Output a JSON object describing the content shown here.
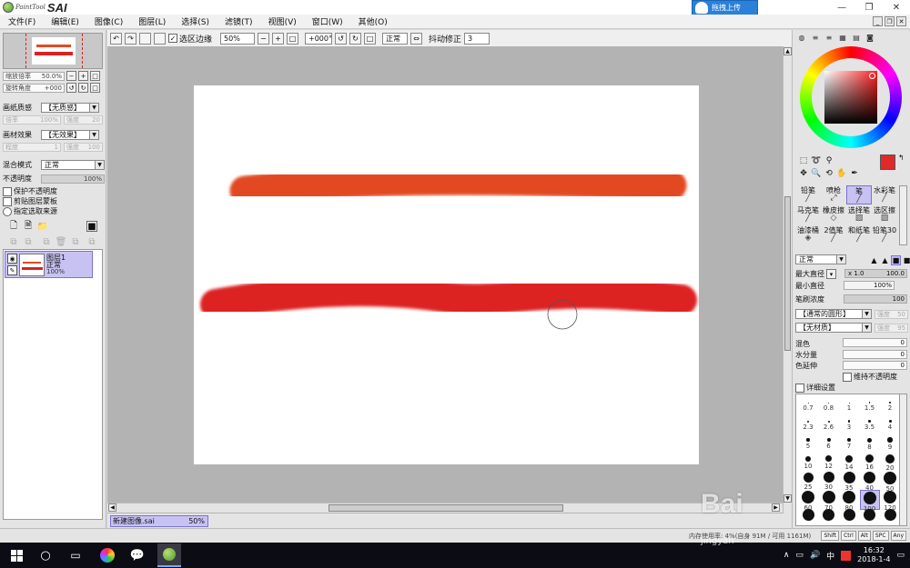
{
  "app": {
    "logo_small": "PaintTool",
    "logo_big": "SAI",
    "upload_button": "拖拽上传",
    "window_controls": [
      "—",
      "❐",
      "✕"
    ]
  },
  "menu": [
    "文件(F)",
    "编辑(E)",
    "图像(C)",
    "图层(L)",
    "选择(S)",
    "滤镜(T)",
    "视图(V)",
    "窗口(W)",
    "其他(O)"
  ],
  "toolbar": {
    "selection_edge_label": "选区边缘",
    "selection_edge_checked": true,
    "zoom": "50%",
    "rotation": "+000°",
    "blend_mode": "正常",
    "stabilizer_label": "抖动修正",
    "stabilizer_value": "3"
  },
  "navigator": {
    "zoom_label": "缩放倍率",
    "zoom_value": "50.0%",
    "rotate_label": "旋转角度",
    "rotate_value": "+000"
  },
  "left_panel": {
    "paper_texture_label": "画纸质感",
    "paper_texture_value": "【无质感】",
    "scale_label": "倍率",
    "scale_value": "100%",
    "strength_label": "强度",
    "strength_value": "20",
    "paper_effect_label": "画材效果",
    "paper_effect_value": "【无效果】",
    "degree_label": "程度",
    "degree_value": "1",
    "strength2_value": "100",
    "blend_mode_label": "混合模式",
    "blend_mode_value": "正常",
    "opacity_label": "不透明度",
    "opacity_value": "100%",
    "checks": [
      "保护不透明度",
      "剪贴图层蒙板",
      "指定选取来源"
    ]
  },
  "layer": {
    "name": "图层1",
    "mode": "正常",
    "opacity": "100%"
  },
  "document_tab": {
    "name": "新建图像.sai",
    "zoom": "50%"
  },
  "colors": {
    "stroke_top": "#e24a24",
    "stroke_bottom": "#dd2020",
    "foreground": "#e02a2a",
    "selection": "#c7c2f1"
  },
  "brushes": [
    {
      "label": "铅笔"
    },
    {
      "label": "喷枪"
    },
    {
      "label": "笔"
    },
    {
      "label": "水彩笔"
    },
    {
      "label": "马克笔"
    },
    {
      "label": "橡皮擦"
    },
    {
      "label": "选择笔"
    },
    {
      "label": "选区擦"
    },
    {
      "label": "油漆桶"
    },
    {
      "label": "2值笔"
    },
    {
      "label": "和纸笔"
    },
    {
      "label": "铅笔30"
    }
  ],
  "brush_settings": {
    "mode": "正常",
    "max_size_label": "最大直径",
    "max_size_mult": "x 1.0",
    "max_size_value": "100.0",
    "min_size_label": "最小直径",
    "min_size_value": "100%",
    "density_label": "笔刷浓度",
    "density_value": "100",
    "shape_value": "【通常的圆形】",
    "shape_strength_label": "强度",
    "shape_strength_value": "50",
    "texture_value": "【无材质】",
    "texture_strength_label": "强度",
    "texture_strength_value": "95",
    "blend_label": "混色",
    "blend_value": "0",
    "water_label": "水分量",
    "water_value": "0",
    "persistence_label": "色延伸",
    "persistence_value": "0",
    "keep_opacity_label": "维持不透明度",
    "detail_label": "详细设置"
  },
  "brush_sizes": [
    "0.7",
    "0.8",
    "1",
    "1.5",
    "2",
    "2.3",
    "2.6",
    "3",
    "3.5",
    "4",
    "5",
    "6",
    "7",
    "8",
    "9",
    "10",
    "12",
    "14",
    "16",
    "20",
    "25",
    "30",
    "35",
    "40",
    "50",
    "60",
    "70",
    "80",
    "100",
    "120",
    "",
    "",
    "",
    "",
    ""
  ],
  "status": {
    "memory_text": "内存使用率: 4%(自身 91M / 可用 1161M)",
    "indicators": [
      "Shift",
      "Ctrl",
      "Alt",
      "SPC",
      "Any"
    ]
  },
  "taskbar": {
    "tray_glyphs": [
      "∧",
      "▭",
      "🔊",
      "中"
    ],
    "time": "16:32",
    "date": "2018-1-4"
  },
  "watermark": {
    "text": "Bai",
    "sub": "jingyan"
  }
}
